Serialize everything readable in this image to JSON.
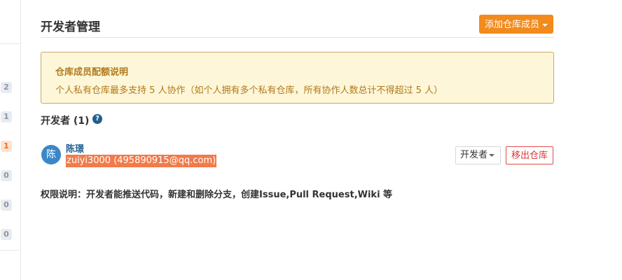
{
  "header": {
    "title": "开发者管理",
    "add_member_label": "添加仓库成员"
  },
  "notice": {
    "title": "仓库成员配额说明",
    "body": "个人私有仓库最多支持 5 人协作（如个人拥有多个私有仓库，所有协作人数总计不得超过 5 人）"
  },
  "developers": {
    "heading": "开发者 (1)",
    "help_icon": "?",
    "members": [
      {
        "avatar_char": "陈",
        "name": "陈璟",
        "id_email": "zuiyi3000 (495890915@qq.com)",
        "role": "开发者",
        "remove_label": "移出仓库"
      }
    ]
  },
  "permission_note": "权限说明：开发者能推送代码，新建和删除分支，创建Issue,Pull Request,Wiki 等",
  "sidebar": {
    "badges": [
      "2",
      "1",
      "1",
      "0",
      "0",
      "0"
    ]
  },
  "colors": {
    "accent": "#f28a1c",
    "link": "#1f5f91",
    "danger": "#d93a3a",
    "notice_bg": "#fef6d8",
    "selection": "#f17b4a"
  }
}
